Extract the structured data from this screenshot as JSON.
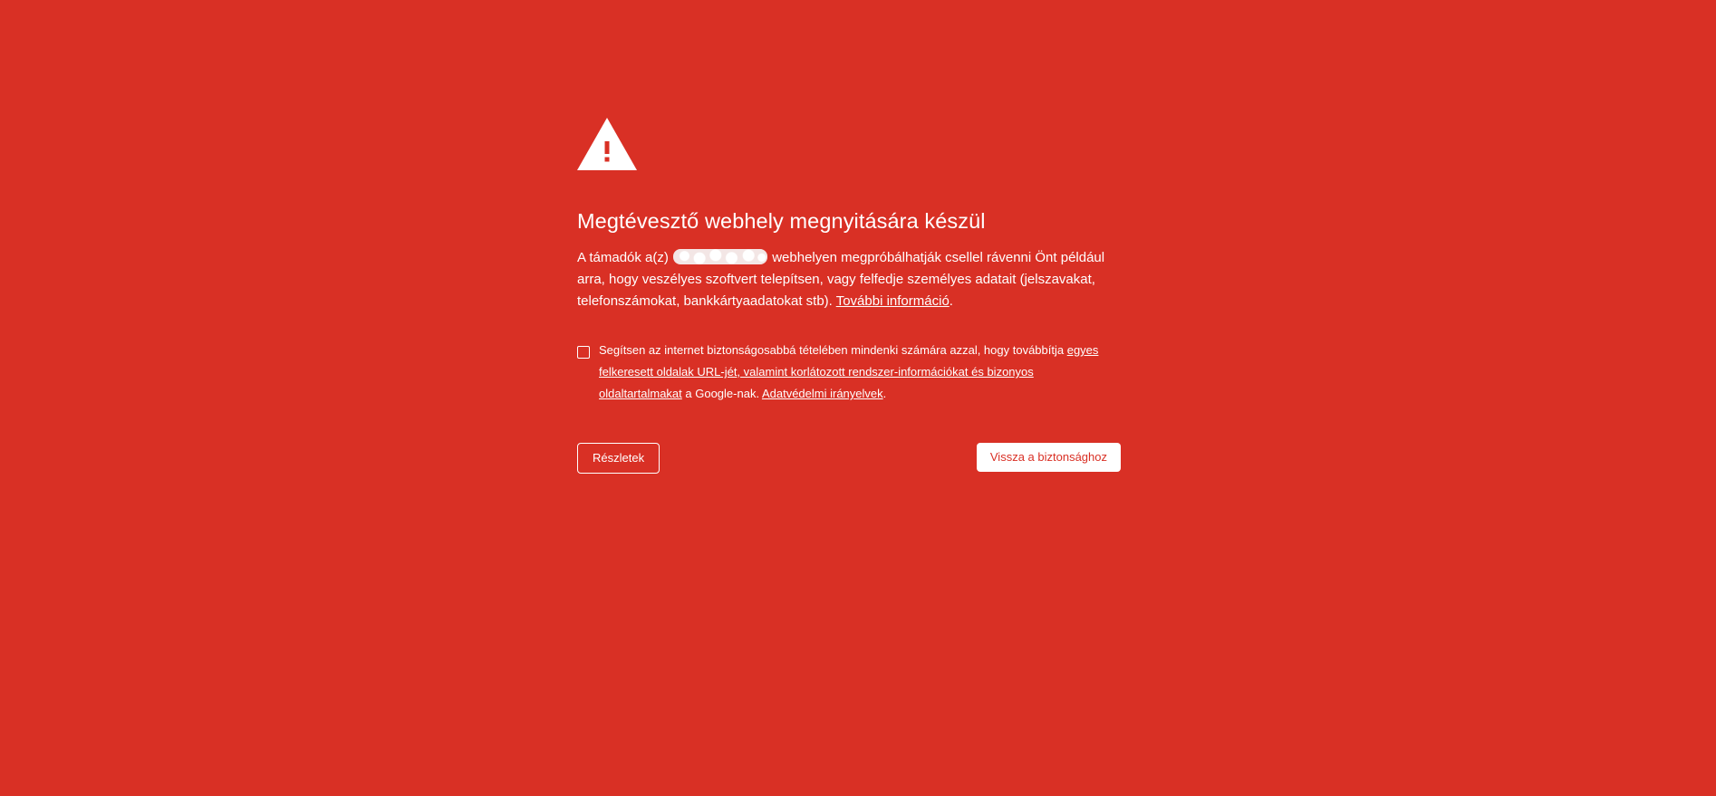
{
  "colors": {
    "background": "#d93025",
    "text": "#ffffff",
    "primary_button_text": "#d93025"
  },
  "icon": "warning-triangle-icon",
  "heading": "Megtévesztő webhely megnyitására készül",
  "body": {
    "before_site": "A támadók a(z) ",
    "after_site": " webhelyen megpróbálhatják csellel rávenni Önt például arra, hogy veszélyes szoftvert telepítsen, vagy felfedje személyes adatait (jelszavakat, telefonszámokat, bankkártyaadatokat stb). ",
    "more_info_link": "További információ",
    "end": "."
  },
  "optin": {
    "checked": false,
    "text_before": "Segítsen az internet biztonságosabbá tételében mindenki számára azzal, hogy továbbítja ",
    "link_data": "egyes felkeresett oldalak URL-jét, valamint korlátozott rendszer-információkat és bizonyos oldaltartalmakat",
    "text_middle": " a Google-nak. ",
    "link_privacy": "Adatvédelmi irányelvek",
    "text_end": "."
  },
  "buttons": {
    "details_label": "Részletek",
    "back_label": "Vissza a biztonsághoz"
  }
}
